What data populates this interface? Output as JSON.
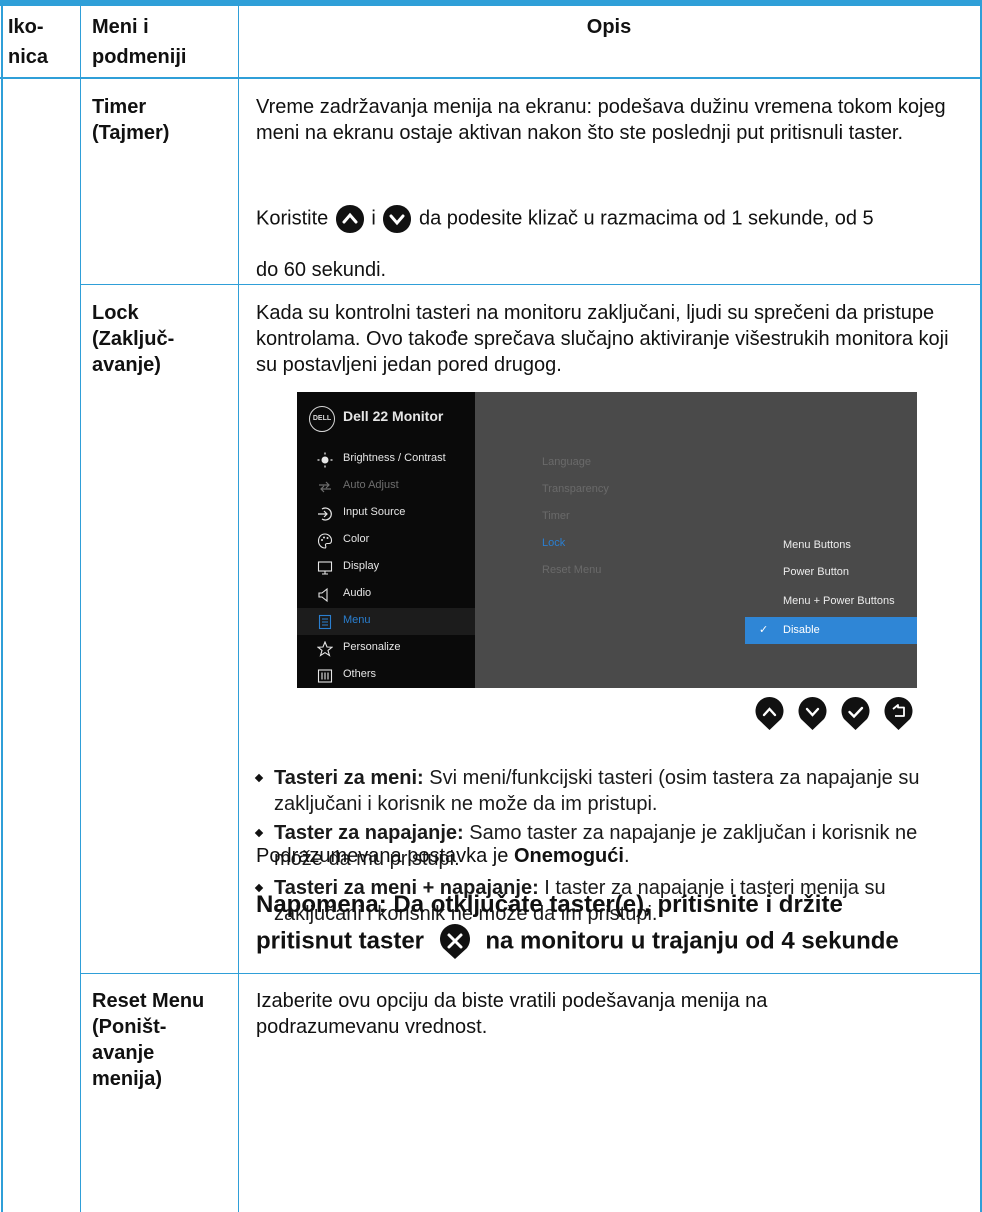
{
  "headers": {
    "icon": "Iko-\nnica",
    "icon_l1": "Iko-",
    "icon_l2": "nica",
    "menu_l1": "Meni i",
    "menu_l2": "podmeniji",
    "desc": "Opis"
  },
  "rows": {
    "timer": {
      "name_l1": "Timer",
      "name_l2": "(Tajmer)",
      "p1": "Vreme zadržavanja menija na ekranu: podešava dužinu vremena tokom kojeg meni na ekranu ostaje aktivan nakon što ste poslednji put pritisnuli taster.",
      "p2_before": "Koristite",
      "p2_mid": "i",
      "p2_after": "da podesite klizač u razmacima od 1 sekunde, od 5",
      "p3": "do 60 sekundi."
    },
    "lock": {
      "name_l1": "Lock",
      "name_l2": "(Zaključ-",
      "name_l3": "avanje)",
      "p1": "Kada su kontrolni tasteri na monitoru zaključani, ljudi su sprečeni da pristupe kontrolama. Ovo takođe sprečava slučajno aktiviranje višestrukih monitora koji su postavljeni jedan pored drugog.",
      "bullets": [
        {
          "bold": "Tasteri za meni:",
          "text": " Svi meni/funkcijski tasteri (osim tastera za napajanje su zaključani i korisnik ne može da im pristupi."
        },
        {
          "bold": "Taster za napajanje:",
          "text": " Samo taster za napajanje je zaključan i korisnik ne može da mu pristupi."
        },
        {
          "bold": "Tasteri za meni + napajanje:",
          "text": " I taster za napajanje i tasteri menija su zaključani i korisnik ne može da im pristupi."
        }
      ],
      "default_before": "Podrazumevana postavka je ",
      "default_bold": "Onemogući",
      "default_after": ".",
      "note_l1": "Napomena: Da otključate taster(e), pritisnite i držite",
      "note_l2_before": "pritisnut taster",
      "note_l2_after": "na monitoru u trajanju od 4 sekunde"
    },
    "reset": {
      "name_l1": "Reset Menu",
      "name_l2": "(Poništ-",
      "name_l3": "avanje",
      "name_l4": "menija)",
      "p1": "Izaberite ovu opciju da biste vratili podešavanja menija na podrazumevanu vrednost."
    }
  },
  "osd": {
    "logo": "DELL",
    "title": "Dell 22 Monitor",
    "menu_items": [
      {
        "label": "Brightness / Contrast",
        "icon": "brightness-icon",
        "state": "normal"
      },
      {
        "label": "Auto Adjust",
        "icon": "auto-adjust-icon",
        "state": "dim"
      },
      {
        "label": "Input Source",
        "icon": "input-source-icon",
        "state": "normal"
      },
      {
        "label": "Color",
        "icon": "color-icon",
        "state": "normal"
      },
      {
        "label": "Display",
        "icon": "display-icon",
        "state": "normal"
      },
      {
        "label": "Audio",
        "icon": "audio-icon",
        "state": "normal"
      },
      {
        "label": "Menu",
        "icon": "menu-icon",
        "state": "selected"
      },
      {
        "label": "Personalize",
        "icon": "star-icon",
        "state": "normal"
      },
      {
        "label": "Others",
        "icon": "others-icon",
        "state": "normal"
      }
    ],
    "submenu": [
      "Language",
      "Transparency",
      "Timer",
      "Lock",
      "Reset Menu"
    ],
    "submenu_active": "Lock",
    "options": [
      "Menu Buttons",
      "Power Button",
      "Menu + Power Buttons",
      "Disable"
    ],
    "option_selected": "Disable",
    "nav_buttons": [
      "up-button-icon",
      "down-button-icon",
      "check-button-icon",
      "back-button-icon"
    ]
  },
  "colors": {
    "border": "#2f9fd8",
    "osd_bg": "#4a4a4a",
    "osd_left": "#0a0a0a",
    "osd_highlight": "#2f86d6",
    "osd_active_text": "#2a7fd0"
  }
}
